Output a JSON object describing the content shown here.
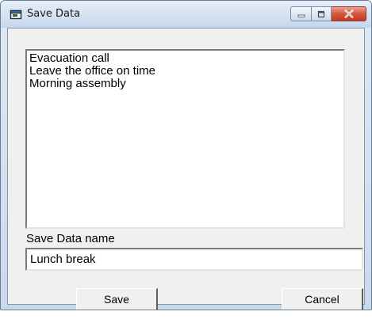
{
  "window": {
    "title": "Save Data"
  },
  "list": {
    "items": [
      "Evacuation call",
      "Leave the office on time",
      "Morning assembly"
    ]
  },
  "form": {
    "name_label": "Save Data name",
    "name_value": "Lunch break"
  },
  "buttons": {
    "save_label": "Save",
    "cancel_label": "Cancel"
  },
  "icons": {
    "title_icon": "window-app-icon",
    "minimize": "minimize-icon",
    "maximize": "maximize-icon",
    "close": "close-icon"
  },
  "colors": {
    "close_button": "#c23c23",
    "title_bar": "#d6e3f2",
    "client_background": "#f0f0f0"
  }
}
